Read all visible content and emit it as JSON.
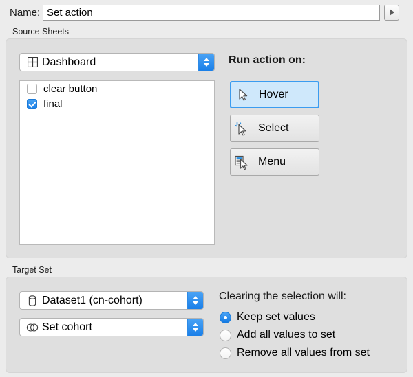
{
  "name_row": {
    "label": "Name:",
    "value": "Set action",
    "placeholder": "Name",
    "menu_button_icon": "play-triangle-icon"
  },
  "source_sheets": {
    "title": "Source Sheets",
    "sheet_popup": {
      "icon": "dashboard-grid-icon",
      "value": "Dashboard",
      "options": [
        "Dashboard"
      ]
    },
    "sheets": [
      {
        "label": "clear button",
        "checked": false
      },
      {
        "label": "final",
        "checked": true
      }
    ]
  },
  "run_action": {
    "label": "Run action on:",
    "selected": "Hover",
    "buttons": [
      {
        "label": "Hover",
        "icon": "pointer-arrow-icon",
        "selected": true
      },
      {
        "label": "Select",
        "icon": "pointer-click-icon",
        "selected": false
      },
      {
        "label": "Menu",
        "icon": "pointer-menu-icon",
        "selected": false
      }
    ]
  },
  "target_set": {
    "title": "Target Set",
    "dataset_popup": {
      "icon": "database-icon",
      "value": "Dataset1 (cn-cohort)",
      "options": [
        "Dataset1 (cn-cohort)"
      ]
    },
    "set_popup": {
      "icon": "set-venn-icon",
      "value": "Set cohort",
      "options": [
        "Set cohort"
      ]
    },
    "clearing": {
      "label": "Clearing the selection will:",
      "selected": "Keep set values",
      "options": [
        {
          "label": "Keep set values",
          "selected": true
        },
        {
          "label": "Add all values to set",
          "selected": false
        },
        {
          "label": "Remove all values from set",
          "selected": false
        }
      ]
    }
  },
  "colors": {
    "accent_blue": "#1b81ea",
    "selected_button_fill": "#cfe8fb",
    "selected_button_border": "#3b9cf0",
    "window_background": "#ececec",
    "group_background": "#dfdfdf"
  }
}
